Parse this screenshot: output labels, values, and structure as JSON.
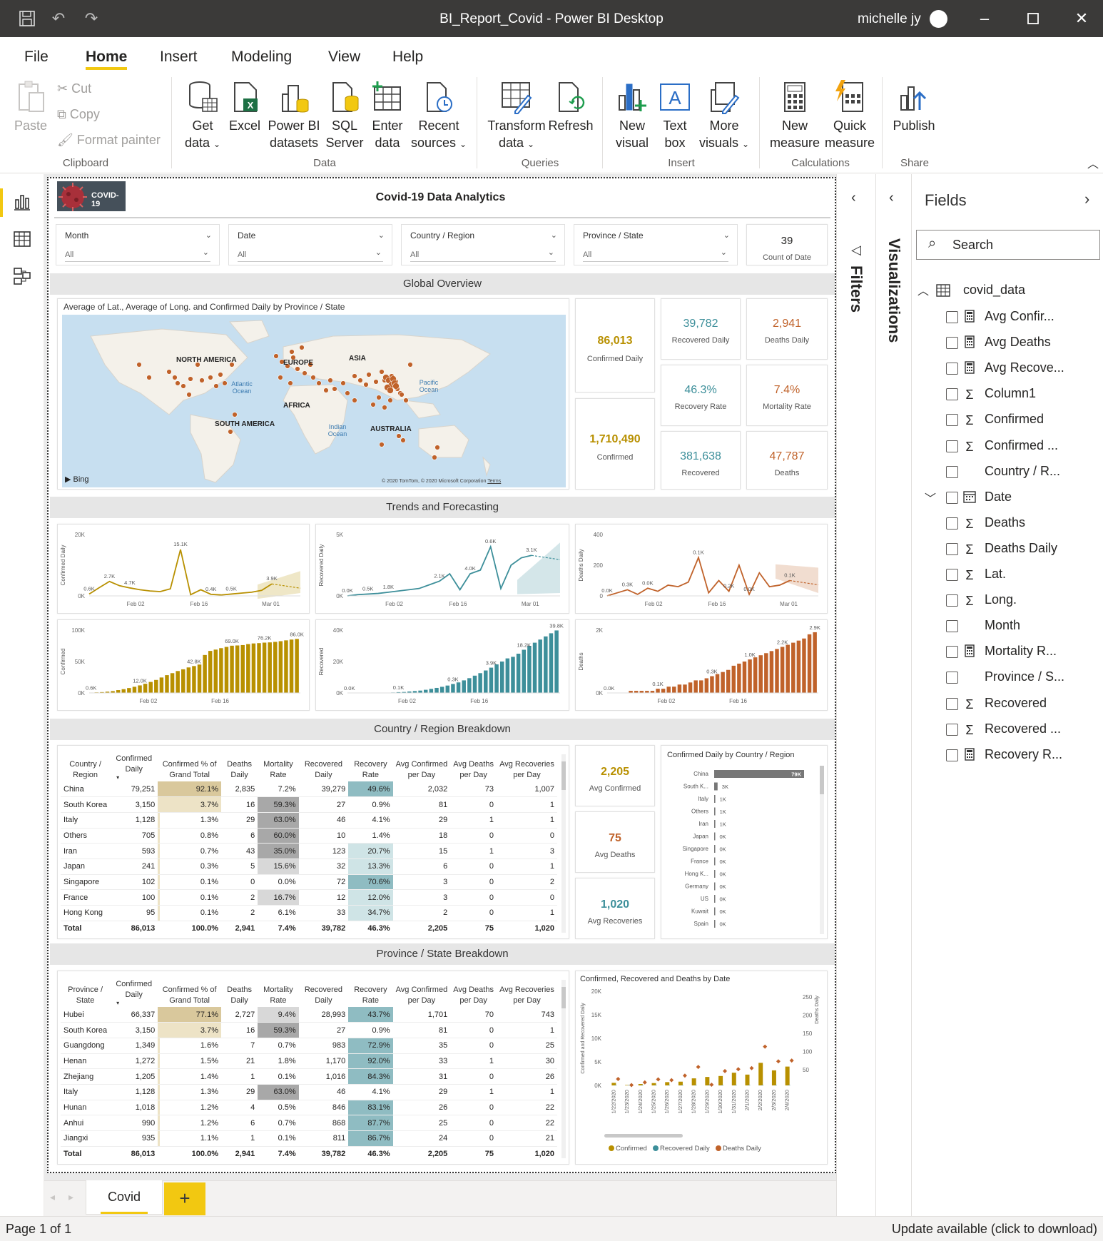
{
  "window": {
    "title": "BI_Report_Covid - Power BI Desktop",
    "user": "michelle jy"
  },
  "menu": [
    {
      "label": "File"
    },
    {
      "label": "Home"
    },
    {
      "label": "Insert"
    },
    {
      "label": "Modeling"
    },
    {
      "label": "View"
    },
    {
      "label": "Help"
    }
  ],
  "ribbon": {
    "clipboard": {
      "paste": "Paste",
      "cut": "Cut",
      "copy": "Copy",
      "format_painter": "Format painter",
      "group": "Clipboard"
    },
    "data": {
      "get_data": [
        "Get",
        "data"
      ],
      "excel": [
        "Excel",
        ""
      ],
      "pbi_datasets": [
        "Power BI",
        "datasets"
      ],
      "sql_server": [
        "SQL",
        "Server"
      ],
      "enter_data": [
        "Enter",
        "data"
      ],
      "recent_sources": [
        "Recent",
        "sources"
      ],
      "group": "Data"
    },
    "queries": {
      "transform": [
        "Transform",
        "data"
      ],
      "refresh": [
        "Refresh",
        ""
      ],
      "group": "Queries"
    },
    "insert": {
      "new_visual": [
        "New",
        "visual"
      ],
      "text_box": [
        "Text",
        "box"
      ],
      "more_visuals": [
        "More",
        "visuals"
      ],
      "group": "Insert"
    },
    "calculations": {
      "new_measure": [
        "New",
        "measure"
      ],
      "quick_measure": [
        "Quick",
        "measure"
      ],
      "group": "Calculations"
    },
    "share": {
      "publish": "Publish",
      "group": "Share"
    }
  },
  "report": {
    "logo_text": "COVID-19",
    "title": "Covid-19 Data Analytics",
    "slicers": [
      {
        "label": "Month",
        "value": "All"
      },
      {
        "label": "Date",
        "value": "All"
      },
      {
        "label": "Country / Region",
        "value": "All"
      },
      {
        "label": "Province / State",
        "value": "All"
      }
    ],
    "count_card": {
      "value": "39",
      "label": "Count of Date"
    },
    "sections": {
      "global": "Global Overview",
      "trends": "Trends and Forecasting",
      "country": "Country / Region Breakdown",
      "province": "Province / State Breakdown"
    },
    "map": {
      "title": "Average of Lat., Average of Long. and Confirmed Daily by Province / State",
      "labels": {
        "na": "NORTH AMERICA",
        "eu": "EUROPE",
        "asia": "ASIA",
        "af": "AFRICA",
        "sa": "SOUTH AMERICA",
        "au": "AUSTRALIA",
        "atl": "Atlantic Ocean",
        "pac": "Pacific Ocean",
        "ind": "Indian Ocean"
      },
      "bing": "Bing",
      "copyright": "© 2020 TomTom, © 2020 Microsoft Corporation",
      "terms": "Terms"
    },
    "kpis": {
      "confirmed_daily": {
        "value": "86,013",
        "label": "Confirmed Daily",
        "color": "#b89000"
      },
      "confirmed": {
        "value": "1,710,490",
        "label": "Confirmed",
        "color": "#b89000"
      },
      "recovered_daily": {
        "value": "39,782",
        "label": "Recovered Daily",
        "color": "#3d8f9a"
      },
      "deaths_daily": {
        "value": "2,941",
        "label": "Deaths Daily",
        "color": "#c0622a"
      },
      "recovery_rate": {
        "value": "46.3%",
        "label": "Recovery Rate",
        "color": "#3d8f9a"
      },
      "mortality_rate": {
        "value": "7.4%",
        "label": "Mortality Rate",
        "color": "#c0622a"
      },
      "recovered": {
        "value": "381,638",
        "label": "Recovered",
        "color": "#3d8f9a"
      },
      "deaths": {
        "value": "47,787",
        "label": "Deaths",
        "color": "#c0622a"
      },
      "avg_confirmed": {
        "value": "2,205",
        "label": "Avg Confirmed",
        "color": "#b89000"
      },
      "avg_deaths": {
        "value": "75",
        "label": "Avg Deaths",
        "color": "#c0622a"
      },
      "avg_recoveries": {
        "value": "1,020",
        "label": "Avg Recoveries",
        "color": "#3d8f9a"
      }
    },
    "table_headers": [
      "Confirmed Daily",
      "Confirmed % of Grand Total",
      "Deaths Daily",
      "Mortality Rate",
      "Recovered Daily",
      "Recovery Rate",
      "Avg Confirmed per Day",
      "Avg Deaths per Day",
      "Avg Recoveries per Day"
    ],
    "country_table": {
      "first_header": "Country / Region",
      "rows": [
        [
          "China",
          "79,251",
          "92.1%",
          "2,835",
          "7.2%",
          "39,279",
          "49.6%",
          "2,032",
          "73",
          "1,007"
        ],
        [
          "South Korea",
          "3,150",
          "3.7%",
          "16",
          "59.3%",
          "27",
          "0.9%",
          "81",
          "0",
          "1"
        ],
        [
          "Italy",
          "1,128",
          "1.3%",
          "29",
          "63.0%",
          "46",
          "4.1%",
          "29",
          "1",
          "1"
        ],
        [
          "Others",
          "705",
          "0.8%",
          "6",
          "60.0%",
          "10",
          "1.4%",
          "18",
          "0",
          "0"
        ],
        [
          "Iran",
          "593",
          "0.7%",
          "43",
          "35.0%",
          "123",
          "20.7%",
          "15",
          "1",
          "3"
        ],
        [
          "Japan",
          "241",
          "0.3%",
          "5",
          "15.6%",
          "32",
          "13.3%",
          "6",
          "0",
          "1"
        ],
        [
          "Singapore",
          "102",
          "0.1%",
          "0",
          "0.0%",
          "72",
          "70.6%",
          "3",
          "0",
          "2"
        ],
        [
          "France",
          "100",
          "0.1%",
          "2",
          "16.7%",
          "12",
          "12.0%",
          "3",
          "0",
          "0"
        ],
        [
          "Hong Kong",
          "95",
          "0.1%",
          "2",
          "6.1%",
          "33",
          "34.7%",
          "2",
          "0",
          "1"
        ]
      ],
      "total": [
        "Total",
        "86,013",
        "100.0%",
        "2,941",
        "7.4%",
        "39,782",
        "46.3%",
        "2,205",
        "75",
        "1,020"
      ]
    },
    "province_table": {
      "first_header": "Province / State",
      "rows": [
        [
          "Hubei",
          "66,337",
          "77.1%",
          "2,727",
          "9.4%",
          "28,993",
          "43.7%",
          "1,701",
          "70",
          "743"
        ],
        [
          "South Korea",
          "3,150",
          "3.7%",
          "16",
          "59.3%",
          "27",
          "0.9%",
          "81",
          "0",
          "1"
        ],
        [
          "Guangdong",
          "1,349",
          "1.6%",
          "7",
          "0.7%",
          "983",
          "72.9%",
          "35",
          "0",
          "25"
        ],
        [
          "Henan",
          "1,272",
          "1.5%",
          "21",
          "1.8%",
          "1,170",
          "92.0%",
          "33",
          "1",
          "30"
        ],
        [
          "Zhejiang",
          "1,205",
          "1.4%",
          "1",
          "0.1%",
          "1,016",
          "84.3%",
          "31",
          "0",
          "26"
        ],
        [
          "Italy",
          "1,128",
          "1.3%",
          "29",
          "63.0%",
          "46",
          "4.1%",
          "29",
          "1",
          "1"
        ],
        [
          "Hunan",
          "1,018",
          "1.2%",
          "4",
          "0.5%",
          "846",
          "83.1%",
          "26",
          "0",
          "22"
        ],
        [
          "Anhui",
          "990",
          "1.2%",
          "6",
          "0.7%",
          "868",
          "87.7%",
          "25",
          "0",
          "22"
        ],
        [
          "Jiangxi",
          "935",
          "1.1%",
          "1",
          "0.1%",
          "811",
          "86.7%",
          "24",
          "0",
          "21"
        ]
      ],
      "total": [
        "Total",
        "86,013",
        "100.0%",
        "2,941",
        "7.4%",
        "39,782",
        "46.3%",
        "2,205",
        "75",
        "1,020"
      ]
    },
    "page_tab": "Covid",
    "status_left": "Page 1 of 1",
    "status_right": "Update available (click to download)"
  },
  "panes": {
    "filters": "Filters",
    "visualizations": "Visualizations",
    "fields_title": "Fields",
    "search_placeholder": "Search",
    "table": "covid_data",
    "fields": [
      {
        "name": "Avg Confir...",
        "type": "calc"
      },
      {
        "name": "Avg Deaths",
        "type": "calc"
      },
      {
        "name": "Avg Recove...",
        "type": "calc"
      },
      {
        "name": "Column1",
        "type": "sum"
      },
      {
        "name": "Confirmed",
        "type": "sum"
      },
      {
        "name": "Confirmed ...",
        "type": "sum"
      },
      {
        "name": "Country / R...",
        "type": "none"
      },
      {
        "name": "Date",
        "type": "date"
      },
      {
        "name": "Deaths",
        "type": "sum"
      },
      {
        "name": "Deaths Daily",
        "type": "sum"
      },
      {
        "name": "Lat.",
        "type": "sum"
      },
      {
        "name": "Long.",
        "type": "sum"
      },
      {
        "name": "Month",
        "type": "none"
      },
      {
        "name": "Mortality R...",
        "type": "calc"
      },
      {
        "name": "Province / S...",
        "type": "none"
      },
      {
        "name": "Recovered",
        "type": "sum"
      },
      {
        "name": "Recovered ...",
        "type": "sum"
      },
      {
        "name": "Recovery R...",
        "type": "calc"
      }
    ]
  },
  "chart_data": [
    {
      "type": "line",
      "ylabel": "Confirmed Daily",
      "yticks": [
        "20K",
        "0K"
      ],
      "ylim": [
        0,
        20000
      ],
      "xticks": [
        "Feb 02",
        "Feb 16",
        "Mar 01"
      ],
      "series": [
        {
          "values": [
            600,
            2700,
            4700,
            3300,
            2600,
            2000,
            1600,
            1400,
            2300,
            15100,
            400,
            2000,
            500,
            300,
            600,
            900,
            1200,
            1800,
            3900
          ]
        }
      ],
      "data_labels": [
        "0.6K",
        "2.7K",
        "4.7K",
        "15.1K",
        "0.4K",
        "0.5K",
        "3.9K"
      ],
      "color": "#b89000",
      "forecast": true
    },
    {
      "type": "line",
      "ylabel": "Recovered Daily",
      "yticks": [
        "5K",
        "0K"
      ],
      "ylim": [
        0,
        5000
      ],
      "xticks": [
        "Feb 02",
        "Feb 16",
        "Mar 01"
      ],
      "series": [
        {
          "values": [
            0,
            100,
            150,
            200,
            300,
            400,
            500,
            600,
            900,
            1200,
            1800,
            500,
            1800,
            2100,
            4000,
            600,
            2500,
            3100,
            3300
          ]
        }
      ],
      "data_labels": [
        "0.0K",
        "0.5K",
        "1.8K",
        "2.1K",
        "4.0K",
        "0.6K",
        "3.1K"
      ],
      "color": "#3d8f9a",
      "forecast": true
    },
    {
      "type": "line",
      "ylabel": "Deaths Daily",
      "yticks": [
        "400",
        "200",
        "0"
      ],
      "ylim": [
        0,
        400
      ],
      "xticks": [
        "Feb 02",
        "Feb 16",
        "Mar 01"
      ],
      "series": [
        {
          "values": [
            0,
            20,
            40,
            10,
            50,
            30,
            70,
            60,
            90,
            250,
            20,
            100,
            30,
            200,
            10,
            150,
            60,
            70,
            100
          ]
        }
      ],
      "data_labels": [
        "0.0K",
        "0.3K",
        "0.0K",
        "0.1K",
        "0.2K",
        "0.0K",
        "0.1K"
      ],
      "color": "#c0622a",
      "forecast": true
    },
    {
      "type": "bar",
      "ylabel": "Confirmed",
      "yticks": [
        "100K",
        "50K",
        "0K"
      ],
      "ylim": [
        0,
        100000
      ],
      "xticks": [
        "Feb 02",
        "Feb 16"
      ],
      "values": [
        600,
        900,
        1300,
        2000,
        2900,
        4500,
        6000,
        7800,
        9800,
        12000,
        14600,
        17500,
        20700,
        24600,
        28300,
        31500,
        34900,
        37600,
        40600,
        42800,
        45200,
        60400,
        66900,
        69000,
        71300,
        73300,
        75200,
        75600,
        76200,
        77800,
        78800,
        79300,
        80100,
        80500,
        81300,
        82400,
        83700,
        85000,
        86000
      ],
      "data_labels": [
        "0.6K",
        "12.0K",
        "42.8K",
        "69.0K",
        "76.2K",
        "86.0K"
      ],
      "color": "#b89000"
    },
    {
      "type": "bar",
      "ylabel": "Recovered",
      "yticks": [
        "40K",
        "20K",
        "0K"
      ],
      "ylim": [
        0,
        40000
      ],
      "xticks": [
        "Feb 02",
        "Feb 16"
      ],
      "values": [
        0,
        0,
        0,
        100,
        100,
        100,
        100,
        200,
        300,
        500,
        600,
        900,
        1200,
        1500,
        2000,
        2600,
        3200,
        3900,
        4700,
        5700,
        6700,
        8000,
        9400,
        11000,
        12600,
        14300,
        16100,
        18200,
        20000,
        22000,
        23000,
        25000,
        27500,
        30000,
        32000,
        34000,
        36000,
        38000,
        39800
      ],
      "data_labels": [
        "0.0K",
        "0.1K",
        "0.3K",
        "3.9K",
        "18.2K",
        "39.8K"
      ],
      "color": "#3d8f9a"
    },
    {
      "type": "bar",
      "ylabel": "Deaths",
      "yticks": [
        "2K",
        "0K"
      ],
      "ylim": [
        0,
        3000
      ],
      "xticks": [
        "Feb 02",
        "Feb 16"
      ],
      "values": [
        0,
        0,
        0,
        0,
        100,
        100,
        100,
        100,
        100,
        200,
        200,
        300,
        300,
        400,
        400,
        500,
        600,
        600,
        700,
        800,
        900,
        1000,
        1100,
        1300,
        1400,
        1500,
        1600,
        1700,
        1800,
        1900,
        2000,
        2100,
        2200,
        2300,
        2400,
        2500,
        2600,
        2800,
        2900
      ],
      "data_labels": [
        "0.0K",
        "0.1K",
        "0.3K",
        "1.0K",
        "2.2K",
        "2.9K"
      ],
      "color": "#c0622a"
    },
    {
      "type": "bar",
      "title": "Confirmed Daily by Country / Region",
      "orientation": "horizontal",
      "categories": [
        "China",
        "South K...",
        "Italy",
        "Others",
        "Iran",
        "Japan",
        "Singapore",
        "France",
        "Hong K...",
        "Germany",
        "US",
        "Kuwait",
        "Spain"
      ],
      "values": [
        79,
        3,
        1,
        1,
        1,
        0,
        0,
        0,
        0,
        0,
        0,
        0,
        0
      ],
      "data_labels": [
        "79K",
        "3K",
        "1K",
        "1K",
        "1K",
        "0K",
        "0K",
        "0K",
        "0K",
        "0K",
        "0K",
        "0K",
        "0K"
      ],
      "color": "#777777"
    },
    {
      "type": "bar",
      "title": "Confirmed, Recovered and Deaths by Date",
      "ylabel": "Confirmed and Recovered Daily",
      "y2label": "Deaths Daily",
      "yticks": [
        "20K",
        "15K",
        "10K",
        "5K",
        "0K"
      ],
      "y2ticks": [
        "250",
        "200",
        "150",
        "100",
        "50"
      ],
      "ylim": [
        0,
        20000
      ],
      "y2lim": [
        0,
        250
      ],
      "categories": [
        "1/22/2020",
        "1/23/2020",
        "1/24/2020",
        "1/25/2020",
        "1/26/2020",
        "1/27/2020",
        "1/28/2020",
        "1/29/2020",
        "1/30/2020",
        "1/31/2020",
        "2/1/2020",
        "2/2/2020",
        "2/3/2020",
        "2/4/2020"
      ],
      "series": [
        {
          "name": "Confirmed",
          "values": [
            550,
            100,
            300,
            500,
            700,
            800,
            1500,
            1800,
            2000,
            2700,
            2300,
            4800,
            3200,
            4000
          ]
        },
        {
          "name": "Recovered Daily",
          "values": [
            0,
            0,
            0,
            0,
            0,
            0,
            0,
            0,
            0,
            0,
            0,
            0,
            0,
            0
          ]
        },
        {
          "name": "Deaths Daily",
          "values": [
            17,
            1,
            8,
            16,
            14,
            26,
            49,
            2,
            38,
            43,
            46,
            103,
            64,
            66
          ]
        }
      ],
      "legend": "bottom",
      "colors": [
        "#b89000",
        "#3d8f9a",
        "#c0622a"
      ]
    }
  ]
}
